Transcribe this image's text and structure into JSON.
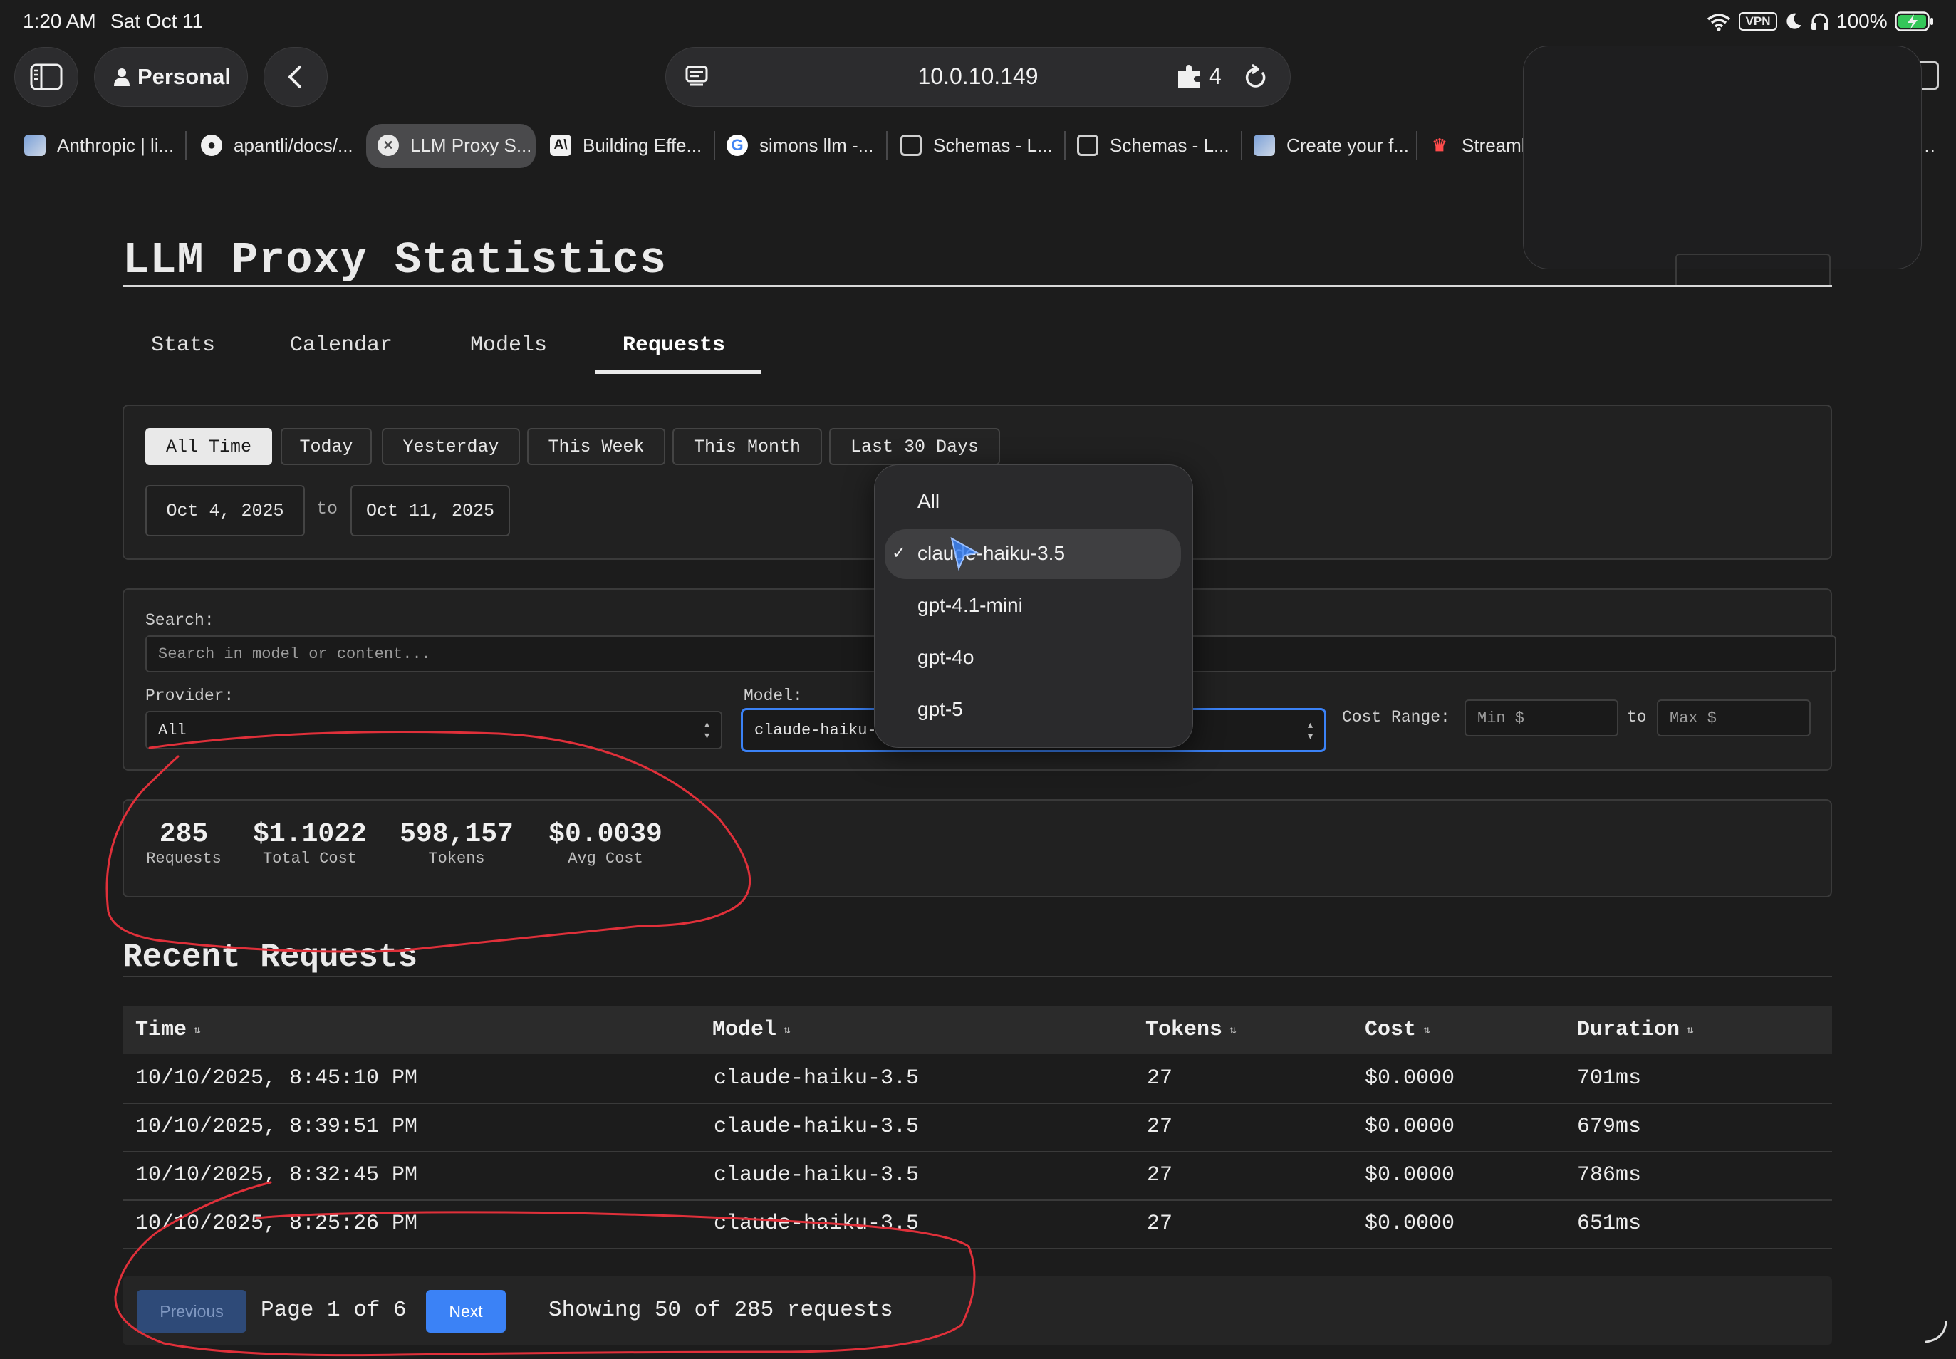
{
  "status_bar": {
    "time": "1:20 AM",
    "date": "Sat Oct 11",
    "vpn": "VPN",
    "battery": "100%"
  },
  "browser": {
    "profile_label": "Personal",
    "url": "10.0.10.149",
    "extensions_count": "4",
    "tabs": [
      {
        "label": "Anthropic | li...",
        "icon": "aws-cloud-icon"
      },
      {
        "label": "apantli/docs/...",
        "icon": "github-icon"
      },
      {
        "label": "LLM Proxy S...",
        "icon": "close-icon"
      },
      {
        "label": "Building Effe...",
        "icon": "anthropic-icon"
      },
      {
        "label": "simons llm -...",
        "icon": "google-icon"
      },
      {
        "label": "Schemas - L...",
        "icon": "docs-icon"
      },
      {
        "label": "Schemas - L...",
        "icon": "docs-icon"
      },
      {
        "label": "Create your f...",
        "icon": "aws-cloud-icon"
      },
      {
        "label": "Streaml",
        "icon": "streamlit-icon"
      }
    ]
  },
  "page": {
    "title": "LLM Proxy Statistics",
    "nav_tabs": [
      "Stats",
      "Calendar",
      "Models",
      "Requests"
    ],
    "active_tab": "Requests"
  },
  "date_filter": {
    "presets": [
      "All Time",
      "Today",
      "Yesterday",
      "This Week",
      "This Month",
      "Last 30 Days"
    ],
    "active_preset": "All Time",
    "start_date": "Oct 4, 2025",
    "to_label": "to",
    "end_date": "Oct 11, 2025"
  },
  "filters": {
    "search_label": "Search:",
    "search_placeholder": "Search in model or content...",
    "provider_label": "Provider:",
    "provider_value": "All",
    "model_label": "Model:",
    "model_value": "claude-haiku-",
    "cost_range_label": "Cost Range:",
    "min_placeholder": "Min $",
    "to_label": "to",
    "max_placeholder": "Max $"
  },
  "model_dropdown": {
    "options": [
      "All",
      "claude-haiku-3.5",
      "gpt-4.1-mini",
      "gpt-4o",
      "gpt-5"
    ],
    "selected": "claude-haiku-3.5",
    "check_mark": "✓"
  },
  "summary": {
    "requests": {
      "value": "285",
      "label": "Requests"
    },
    "total_cost": {
      "value": "$1.1022",
      "label": "Total Cost"
    },
    "tokens": {
      "value": "598,157",
      "label": "Tokens"
    },
    "avg_cost": {
      "value": "$0.0039",
      "label": "Avg Cost"
    }
  },
  "recent": {
    "title": "Recent Requests",
    "columns": [
      "Time",
      "Model",
      "Tokens",
      "Cost",
      "Duration"
    ],
    "sort_glyph": "⇅",
    "rows": [
      [
        "10/10/2025, 8:45:10 PM",
        "claude-haiku-3.5",
        "27",
        "$0.0000",
        "701ms"
      ],
      [
        "10/10/2025, 8:39:51 PM",
        "claude-haiku-3.5",
        "27",
        "$0.0000",
        "679ms"
      ],
      [
        "10/10/2025, 8:32:45 PM",
        "claude-haiku-3.5",
        "27",
        "$0.0000",
        "786ms"
      ],
      [
        "10/10/2025, 8:25:26 PM",
        "claude-haiku-3.5",
        "27",
        "$0.0000",
        "651ms"
      ]
    ]
  },
  "pagination": {
    "previous_label": "Previous",
    "page_text": "Page 1 of 6",
    "next_label": "Next",
    "showing_text": "Showing 50 of 285 requests"
  },
  "colors": {
    "accent_blue": "#3b82f6",
    "annotation_red": "#e0303a",
    "background": "#1c1c1c"
  }
}
